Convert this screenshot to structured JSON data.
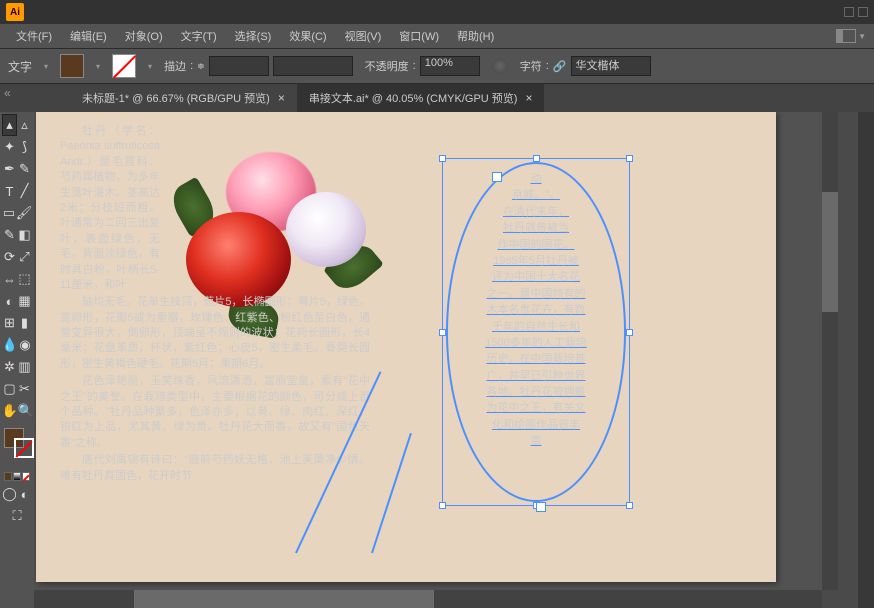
{
  "app": {
    "name": "Ai"
  },
  "menu": {
    "file": "文件(F)",
    "edit": "编辑(E)",
    "object": "对象(O)",
    "type": "文字(T)",
    "select": "选择(S)",
    "effect": "效果(C)",
    "view": "视图(V)",
    "window": "窗口(W)",
    "help": "帮助(H)"
  },
  "options": {
    "tool_label": "文字",
    "stroke_label": "描边",
    "stroke_value": "",
    "opacity_label": "不透明度",
    "opacity_value": "100%",
    "character_label": "字符",
    "font_name": "华文楷体"
  },
  "tabs": {
    "tab1": "未标题-1* @ 66.67% (RGB/GPU 预览)",
    "tab2": "串接文本.ai* @ 40.05% (CMYK/GPU 预览)"
  },
  "colors": {
    "fill": "#5a3a1f"
  },
  "left_text": {
    "p1": "牡丹（学名：Paeonia suffruticosa Andr.）是毛茛科、芍药属植物，为多年生落叶灌木。茎高达2米；分枝短而粗。叶通常为二回三出复叶，表面绿色，无毛，背面淡绿色，有时具白粉，叶柄长5-11厘米，和叶",
    "p2": "轴均无毛。花单生枝顶，苞片5，长椭圆形；萼片5，绿色，宽卵形，花瓣5或为重瓣，玫瑰色、红紫色、粉红色至白色，通常变异很大，倒卵形，顶端呈不规则的波状；花药长圆形，长4毫米；花盘革质，杯状，紫红色；心皮5，密生柔毛。蓇葖长圆形，密生黄褐色硬毛。花期5月；果期6月。",
    "p3": "花色泽艳丽，玉笑珠香，风流潇洒，富丽堂皇，素有\"花中之王\"的美誉。在栽培类型中，主要根据花的颜色，可分成上百个品种。\"牡丹品种繁多，色泽亦多，以黄、绿、肉红、深红、银红为上品，尤其黄、绿为贵。牡丹花大而香，故又有\"国色天香\"之称。",
    "p4": "唐代刘禹锡有诗曰：\"庭前芍药妖无格，池上芙蕖净少情。唯有牡丹真国色，花开时节"
  },
  "ellipse_text": {
    "l1": "动",
    "l2": "京城。\"。",
    "l3": "在清代末年，",
    "l4": "牡丹就曾被当",
    "l5": "作中国的国花。",
    "l6": "1985年5月牡丹被",
    "l7": "评为中国十大名花",
    "l8": "之一。是中国特有的",
    "l9": "木本名贵花卉，有数",
    "l10": "千年的自然生长和",
    "l11": "1500多年的人工栽培",
    "l12": "历史。在中国栽培甚",
    "l13": "广，并早已引种世界",
    "l14": "各地。牡丹花被拥戴",
    "l15": "为花中之王，有关文",
    "l16": "化和绘画作品很丰",
    "l17": "富"
  }
}
